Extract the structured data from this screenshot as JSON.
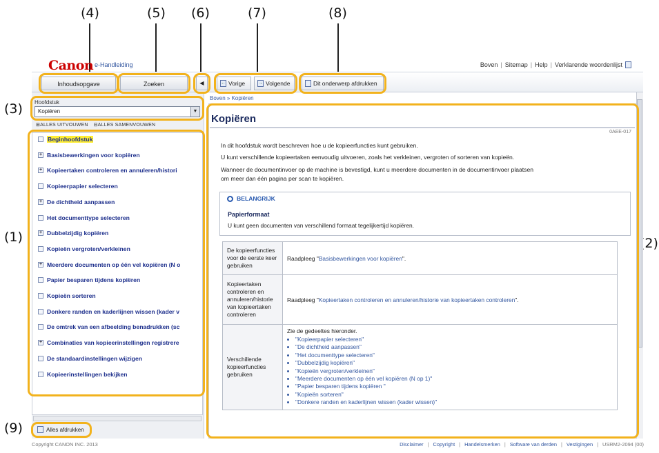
{
  "callouts": [
    "(4)",
    "(5)",
    "(6)",
    "(7)",
    "(8)",
    "(3)",
    "(1)",
    "(2)",
    "(9)"
  ],
  "header": {
    "logo": "Canon",
    "subtitle": "e-Handleiding",
    "links": [
      "Boven",
      "Sitemap",
      "Help",
      "Verklarende woordenlijst"
    ]
  },
  "tabs": {
    "contents": "Inhoudsopgave",
    "search": "Zoeken"
  },
  "toolbar": {
    "collapse_icon": "triangle-left-icon",
    "prev": "Vorige",
    "next": "Volgende",
    "print": "Dit onderwerp afdrukken"
  },
  "chapter": {
    "label": "Hoofdstuk",
    "selected": "Kopiëren",
    "open_all": "ALLES UITVOUWEN",
    "close_all": "ALLES SAMENVOUWEN"
  },
  "tree": [
    {
      "label": "Beginhoofdstuk",
      "icon": "page-icon",
      "active": true
    },
    {
      "label": "Basisbewerkingen voor kopiëren",
      "icon": "plus-icon"
    },
    {
      "label": "Kopieertaken controleren en annuleren/histori",
      "icon": "plus-icon"
    },
    {
      "label": "Kopieerpapier selecteren",
      "icon": "page-icon"
    },
    {
      "label": "De dichtheid aanpassen",
      "icon": "plus-icon"
    },
    {
      "label": "Het documenttype selecteren",
      "icon": "page-icon"
    },
    {
      "label": "Dubbelzijdig kopiëren",
      "icon": "plus-icon"
    },
    {
      "label": "Kopieën vergroten/verkleinen",
      "icon": "page-icon"
    },
    {
      "label": "Meerdere documenten op één vel kopiëren (N o",
      "icon": "plus-icon"
    },
    {
      "label": "Papier besparen tijdens kopiëren",
      "icon": "page-icon"
    },
    {
      "label": "Kopieën sorteren",
      "icon": "page-icon"
    },
    {
      "label": "Donkere randen en kaderlijnen wissen (kader v",
      "icon": "page-icon"
    },
    {
      "label": "De omtrek van een afbeelding benadrukken (sc",
      "icon": "page-icon"
    },
    {
      "label": "Combinaties van kopieerinstellingen registrere",
      "icon": "plus-icon"
    },
    {
      "label": "De standaardinstellingen wijzigen",
      "icon": "page-icon"
    },
    {
      "label": "Kopieerinstellingen bekijken",
      "icon": "page-icon"
    }
  ],
  "print_all": "Alles afdrukken",
  "breadcrumb": "Boven » Kopiëren",
  "page": {
    "title": "Kopiëren",
    "doc_id": "0AEE-017",
    "p1": "In dit hoofdstuk wordt beschreven hoe u de kopieerfuncties kunt gebruiken.",
    "p2": "U kunt verschillende kopieertaken eenvoudig uitvoeren, zoals het verkleinen, vergroten of sorteren van kopieën.",
    "p3": "Wanneer de documentinvoer op de machine is bevestigd, kunt u meerdere documenten in de documentinvoer plaatsen",
    "p3b": "om meer dan één pagina per scan te kopiëren.",
    "note": {
      "heading": "BELANGRIJK",
      "title": "Papierformaat",
      "body": "U kunt geen documenten van verschillend formaat tegelijkertijd kopiëren."
    },
    "table": {
      "row1_key": "De kopieerfuncties voor de eerste keer gebruiken",
      "row1_prefix": "Raadpleeg \"",
      "row1_link": "Basisbewerkingen voor kopiëren",
      "row1_suffix": "\".",
      "row2_key": "Kopieertaken controleren en annuleren/historie van kopieertaken controleren",
      "row2_prefix": "Raadpleeg \"",
      "row2_link": "Kopieertaken controleren en annuleren/historie van kopieertaken controleren",
      "row2_suffix": "\".",
      "row3_key": "Verschillende kopieerfuncties gebruiken",
      "row3_intro": "Zie de gedeeltes hieronder.",
      "row3_items": [
        "\"Kopieerpapier selecteren\"",
        "\"De dichtheid aanpassen\"",
        "\"Het documenttype selecteren\"",
        "\"Dubbelzijdig kopiëren\"",
        "\"Kopieën vergroten/verkleinen\"",
        "\"Meerdere documenten op één vel kopiëren (N op 1)\"",
        "\"Papier besparen tijdens kopiëren \"",
        "\"Kopieën sorteren\"",
        "\"Donkere randen en kaderlijnen wissen (kader wissen)\""
      ]
    }
  },
  "footer": {
    "copyright": "Copyright CANON INC. 2013",
    "links": [
      "Disclaimer",
      "Copyright",
      "Handelsmerken",
      "Software van derden",
      "Vestigingen"
    ],
    "code": "USRM2-2094 (00)"
  },
  "colors": {
    "highlight": "#f2b21c",
    "brand": "#cc0000",
    "link": "#3357a0"
  }
}
